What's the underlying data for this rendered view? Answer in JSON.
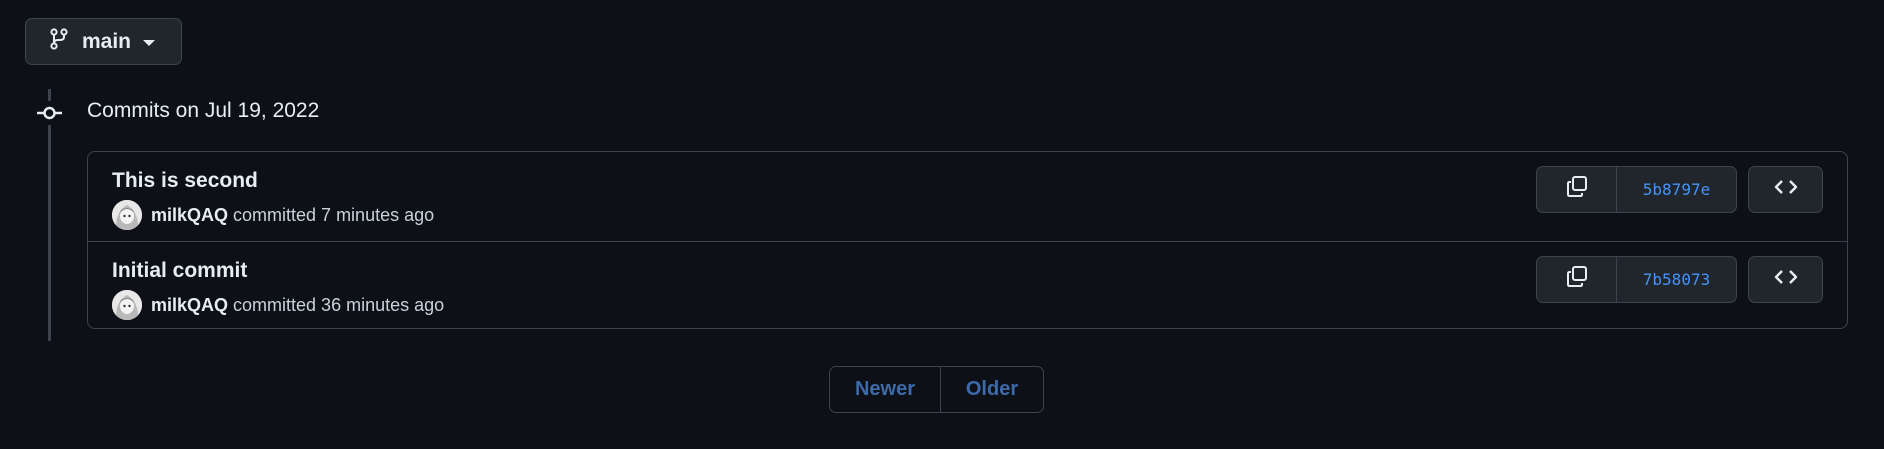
{
  "branch": {
    "name": "main",
    "icon": "git-branch-icon"
  },
  "group": {
    "title": "Commits on Jul 19, 2022"
  },
  "commits": [
    {
      "title": "This is second",
      "author": "milkQAQ",
      "meta": "committed 7 minutes ago",
      "sha": "5b8797e"
    },
    {
      "title": "Initial commit",
      "author": "milkQAQ",
      "meta": "committed 36 minutes ago",
      "sha": "7b58073"
    }
  ],
  "pagination": {
    "newer": "Newer",
    "older": "Older"
  },
  "colors": {
    "background": "#0d1117",
    "border": "#3d444d",
    "sha_link": "#4493f8",
    "disabled_link": "#3d6aa8"
  }
}
